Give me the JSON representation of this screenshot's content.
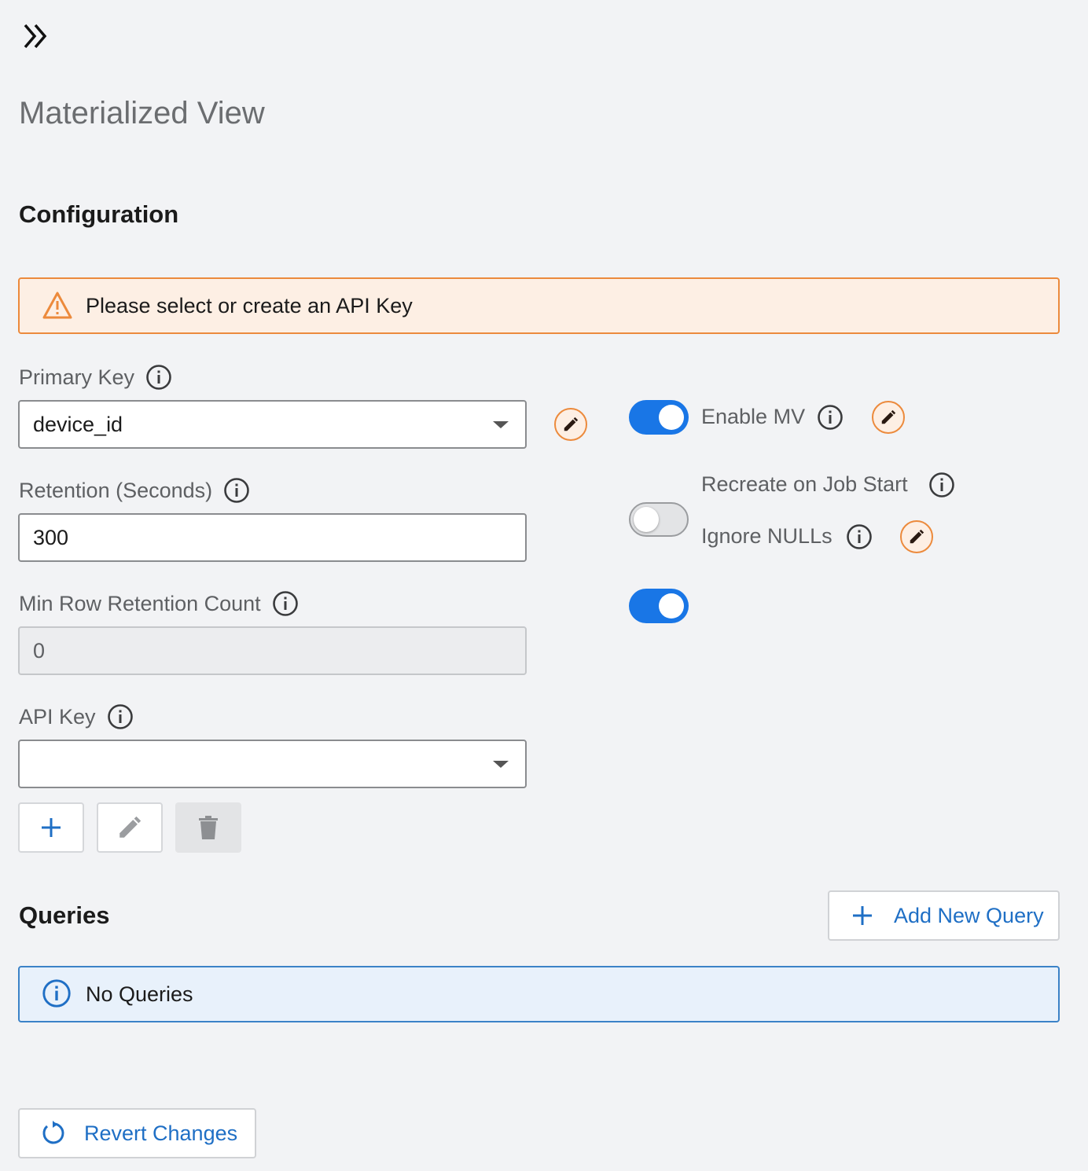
{
  "header": {
    "title": "Materialized View"
  },
  "configuration": {
    "heading": "Configuration",
    "warning": "Please select or create an API Key",
    "primary_key": {
      "label": "Primary Key",
      "value": "device_id"
    },
    "retention": {
      "label": "Retention (Seconds)",
      "value": "300"
    },
    "min_row_retention": {
      "label": "Min Row Retention Count",
      "value": "0"
    },
    "api_key": {
      "label": "API Key",
      "value": ""
    },
    "toggles": [
      {
        "label": "Enable MV",
        "state": "on"
      },
      {
        "label": "Recreate on Job Start",
        "state": "off"
      },
      {
        "label": "Ignore NULLs",
        "state": "on"
      }
    ]
  },
  "queries": {
    "heading": "Queries",
    "add_button": "Add New Query",
    "empty_message": "No Queries"
  },
  "footer": {
    "revert_button": "Revert Changes"
  },
  "colors": {
    "accent": "#1976e6",
    "link": "#1f6fc5",
    "warning_border": "#ec8a3c",
    "warning_bg": "#fdefe4",
    "info_border": "#3b82c7",
    "info_bg": "#e8f1fb",
    "background": "#f2f3f5"
  },
  "icons": [
    "double-chevron-right-icon",
    "warning-triangle-icon",
    "info-icon",
    "pencil-icon",
    "plus-icon",
    "trash-icon",
    "refresh-icon",
    "dropdown-caret-icon"
  ]
}
